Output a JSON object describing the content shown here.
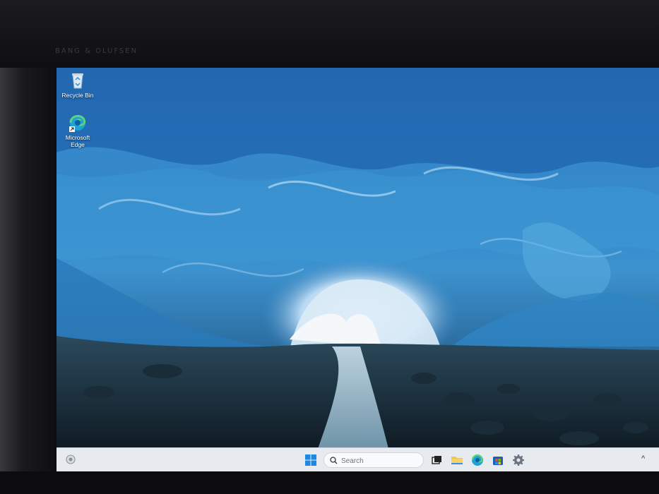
{
  "device": {
    "brand": "BANG & OLUFSEN"
  },
  "desktop": {
    "icons": [
      {
        "label": "Recycle Bin",
        "icon": "recycle-bin-icon"
      },
      {
        "label": "Microsoft Edge",
        "line1": "Microsoft",
        "line2": "Edge",
        "icon": "edge-icon"
      }
    ]
  },
  "taskbar": {
    "search": {
      "placeholder": "Search"
    },
    "pinned": [
      "start-icon",
      "search-icon",
      "task-view-icon",
      "file-explorer-icon",
      "edge-icon",
      "store-icon",
      "settings-icon"
    ],
    "tray": {
      "chevron": "^"
    }
  },
  "colors": {
    "taskbar_bg": "#e7ebf0",
    "windows_blue": "#1e88e5",
    "folder_yellow": "#f4c542"
  }
}
